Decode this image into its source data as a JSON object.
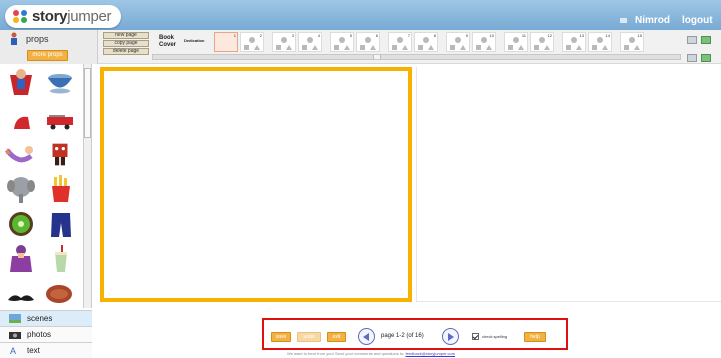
{
  "header": {
    "logo_bold": "story",
    "logo_light": "jumper",
    "username": "Nimrod",
    "logout_label": "logout",
    "colors": {
      "bar": "#8cb8de",
      "logo_dots": [
        "#e9434f",
        "#2e7cd1",
        "#f4b41a",
        "#33a853"
      ]
    }
  },
  "props_panel": {
    "title": "props",
    "more_button": "more props",
    "items": [
      "superhero-cape",
      "teacup",
      "red-cap",
      "fire-truck",
      "mermaid",
      "devil-monster",
      "elephant",
      "french-fries",
      "kiwi",
      "jeans",
      "lady-figure",
      "milkshake",
      "mustache",
      "steak"
    ]
  },
  "page_buttons": [
    "new page",
    "copy page",
    "delete page"
  ],
  "thumbnails": {
    "cover_label": "Book Cover",
    "dedication_label": "Dedication",
    "page_numbers": [
      "1",
      "2",
      "3",
      "4",
      "5",
      "6",
      "7",
      "8",
      "9",
      "10",
      "11",
      "12",
      "13",
      "14",
      "15"
    ],
    "active_page": "1"
  },
  "nav": {
    "scenes": "scenes",
    "photos": "photos",
    "text": "text"
  },
  "bottom_bar": {
    "save": "save",
    "undo": "undo",
    "exit": "exit",
    "page_info": "page 1-2 (of 16)",
    "check_spelling": "check spelling",
    "help": "help",
    "accent_color": "#f2b143",
    "highlight_color": "#e11010"
  },
  "footer": {
    "message": "We want to hear from you! Send your comments and questions to:",
    "email": "feedback@storyjumper.com"
  }
}
